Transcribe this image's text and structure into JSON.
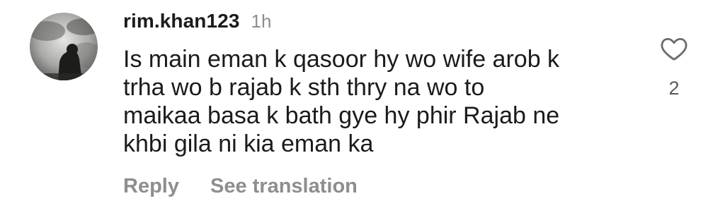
{
  "comment": {
    "username": "rim.khan123",
    "time": "1h",
    "text_lines": [
      "Is main eman k qasoor hy wo wife arob k",
      "trha wo b rajab k sth thry na wo to",
      "maikaa basa k bath gye hy phir Rajab ne",
      "khbi gila ni kia eman ka"
    ],
    "like_count": "2",
    "actions": {
      "reply": "Reply",
      "see_translation": "See translation"
    }
  },
  "icons": {
    "like": "heart-outline-icon",
    "avatar": "profile-photo"
  },
  "colors": {
    "text": "#1b1b1b",
    "muted": "#8e8e8e",
    "background": "#ffffff"
  }
}
